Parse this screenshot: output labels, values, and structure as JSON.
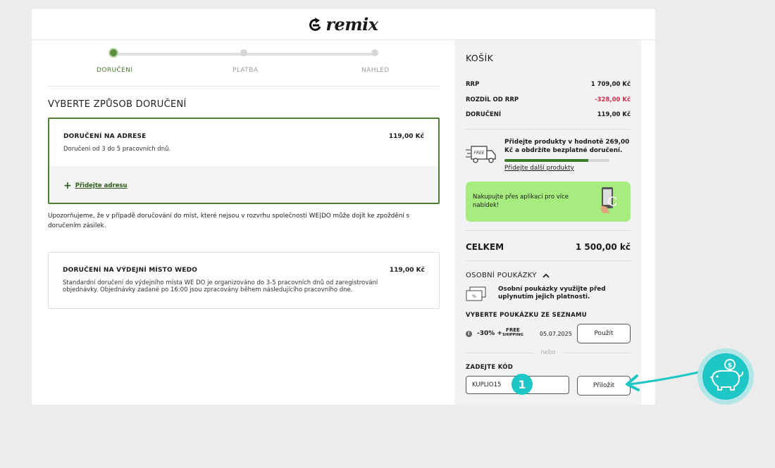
{
  "header": {
    "logo_text": "remix"
  },
  "stepper": {
    "steps": [
      {
        "label": "DORUČENÍ",
        "active": true
      },
      {
        "label": "PLATBA",
        "active": false
      },
      {
        "label": "NÁHLED",
        "active": false
      }
    ]
  },
  "delivery": {
    "title": "VYBERTE ZPŮSOB DORUČENÍ",
    "options": [
      {
        "title": "DORUČENÍ NA ADRESE",
        "price": "119,00 Kč",
        "desc": "Doručení od 3 do 5 pracovních dnů.",
        "add_address": "Přidejte adresu"
      },
      {
        "title": "DORUČENÍ NA VÝDEJNÍ MÍSTO WEDO",
        "price": "119,00 Kč",
        "desc": "Standardní doručení do výdejního místa WE DO je organizováno do 3-5 pracovních dnů od zaregistrování objednávky. Objednávky zadané po 16:00 jsou zpracovány během následujícího pracovního dne."
      }
    ],
    "notice": "Upozorňujeme, že v případě doručování do míst, které nejsou v rozvrhu společnosti WE|DO může dojít ke zpoždění s doručením zásilek."
  },
  "cart": {
    "title": "KOŠÍK",
    "rows": [
      {
        "label": "RRP",
        "value": "1 709,00 Kč"
      },
      {
        "label": "ROZDÍL OD RRP",
        "value": "-328,00 Kč"
      },
      {
        "label": "DORUČENÍ",
        "value": "119,00 Kč"
      }
    ],
    "free_delivery": {
      "truck_label": "FREE",
      "text": "Přidejte produkty v hodnotě 269,00 Kč a obdržíte bezplatné doručení.",
      "progress": 0.8,
      "link": "Přidejte další produkty"
    },
    "app_banner": "Nakupujte přes aplikaci pro více nabídek!",
    "total_label": "CELKEM",
    "total_value": "1 500,00 kč",
    "vouchers": {
      "title": "OSOBNÍ POUKÁZKY",
      "info": "Osobní poukázky využijte před uplynutím jejich platnosti.",
      "choose_label": "VYBERTE POUKÁZKU ZE SEZNAMU",
      "discount": "-30% +",
      "free_top": "FREE",
      "free_bottom": "SHIPPING",
      "date": "05.07.2025",
      "use_button": "Použít",
      "or_text": "nebo",
      "code_label": "ZADEJTE KÓD",
      "code_value": "KUPLIO15",
      "apply_button": "Přiložit"
    }
  },
  "annotation": {
    "step_number": "1",
    "accent": "#1ec6c6"
  }
}
